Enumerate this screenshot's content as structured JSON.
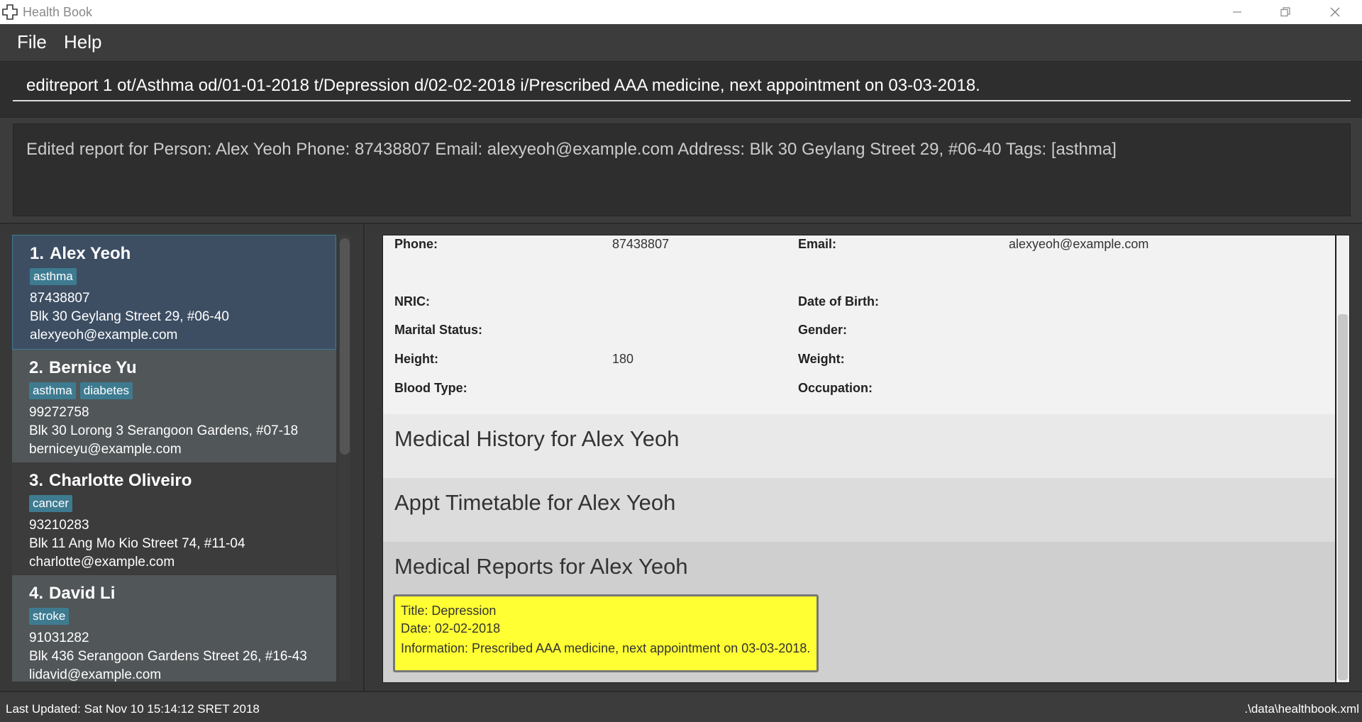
{
  "window": {
    "title": "Health Book",
    "icon": "plus-cross-icon"
  },
  "menu": {
    "items": [
      {
        "label": "File"
      },
      {
        "label": "Help"
      }
    ]
  },
  "command": {
    "value": "editreport 1 ot/Asthma od/01-01-2018 t/Depression d/02-02-2018 i/Prescribed AAA medicine, next appointment on 03-03-2018."
  },
  "result": {
    "text": "Edited report for Person: Alex Yeoh Phone: 87438807 Email: alexyeoh@example.com Address: Blk 30 Geylang Street 29, #06-40 Tags: [asthma]"
  },
  "persons": [
    {
      "index": "1.",
      "name": "Alex Yeoh",
      "tags": [
        "asthma"
      ],
      "phone": "87438807",
      "address": "Blk 30 Geylang Street 29, #06-40",
      "email": "alexyeoh@example.com"
    },
    {
      "index": "2.",
      "name": "Bernice Yu",
      "tags": [
        "asthma",
        "diabetes"
      ],
      "phone": "99272758",
      "address": "Blk 30 Lorong 3 Serangoon Gardens, #07-18",
      "email": "berniceyu@example.com"
    },
    {
      "index": "3.",
      "name": "Charlotte Oliveiro",
      "tags": [
        "cancer"
      ],
      "phone": "93210283",
      "address": "Blk 11 Ang Mo Kio Street 74, #11-04",
      "email": "charlotte@example.com"
    },
    {
      "index": "4.",
      "name": "David Li",
      "tags": [
        "stroke"
      ],
      "phone": "91031282",
      "address": "Blk 436 Serangoon Gardens Street 26, #16-43",
      "email": "lidavid@example.com"
    }
  ],
  "details": {
    "phone_label": "Phone:",
    "phone_value": "87438807",
    "email_label": "Email:",
    "email_value": "alexyeoh@example.com",
    "nric_label": "NRIC:",
    "dob_label": "Date of Birth:",
    "marital_label": "Marital Status:",
    "gender_label": "Gender:",
    "height_label": "Height:",
    "height_value": "180",
    "weight_label": "Weight:",
    "blood_label": "Blood Type:",
    "occupation_label": "Occupation:"
  },
  "sections": {
    "medical_history": "Medical History for Alex Yeoh",
    "appt_timetable": "Appt Timetable for Alex Yeoh",
    "medical_reports": "Medical Reports for Alex Yeoh"
  },
  "report": {
    "title": "Title: Depression",
    "date": "Date: 02-02-2018",
    "information": "Information: Prescribed AAA medicine, next appointment on 03-03-2018."
  },
  "status": {
    "last_updated": "Last Updated: Sat Nov 10 15:14:12 SRET 2018",
    "file_path": ".\\data\\healthbook.xml"
  },
  "colors": {
    "background": "#3c3c3c",
    "selected_card": "#3d4e63",
    "tag": "#3e7b91",
    "report_card": "#ffff33"
  }
}
